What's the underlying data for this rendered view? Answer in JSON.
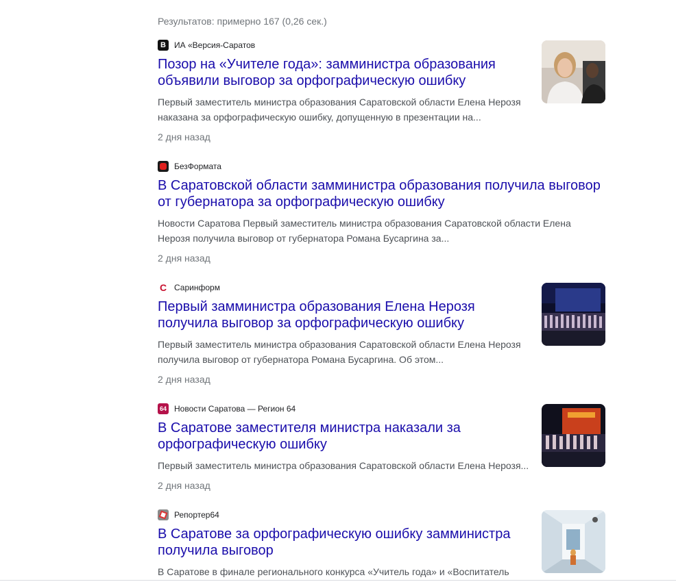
{
  "search": {
    "stats": "Результатов: примерно 167 (0,26 сек.)"
  },
  "results": [
    {
      "source": "ИА «Версия-Саратов",
      "favicon_letter": "В",
      "title_line1": "Позор на «Учителе года»: замминистра образования",
      "title_line2": "объявили выговор за орфографическую ошибку",
      "snippet_line1": "Первый заместитель министра образования Саратовской области Елена Нерозя",
      "snippet_line2": "наказана за орфографическую ошибку, допущенную в презентации на...",
      "time": "2 дня назад"
    },
    {
      "source": "БезФормата",
      "title_line1": "В Саратовской области замминистра образования получила выговор",
      "title_line2": "от губернатора за орфографическую ошибку",
      "snippet_line1": "Новости Саратова Первый заместитель министра образования Саратовской области Елена",
      "snippet_line2": "Нерозя получила выговор от губернатора Романа Бусаргина за...",
      "time": "2 дня назад"
    },
    {
      "source": "Саринформ",
      "favicon_letter": "С",
      "title_line1": "Первый замминистра образования Елена Нерозя",
      "title_line2": "получила выговор за орфографическую ошибку",
      "snippet_line1": "Первый заместитель министра образования Саратовской области Елена Нерозя",
      "snippet_line2": "получила выговор от губернатора Романа Бусаргина. Об этом...",
      "time": "2 дня назад"
    },
    {
      "source": "Новости Саратова — Регион 64",
      "favicon_letter": "64",
      "title_line1": "В Саратове заместителя министра наказали за",
      "title_line2": "орфографическую ошибку",
      "snippet_line1": "Первый заместитель министра образования Саратовской области Елена Нерозя...",
      "time": "2 дня назад"
    },
    {
      "source": "Репортер64",
      "title_line1": "В Саратове за орфографическую ошибку замминистра",
      "title_line2": "получила выговор",
      "snippet_line1": "В Саратове в финале регионального конкурса «Учитель года» и «Воспитатель"
    }
  ],
  "colors": {
    "link": "#1a0dab",
    "snippet": "#4d5156",
    "meta": "#70757a"
  }
}
